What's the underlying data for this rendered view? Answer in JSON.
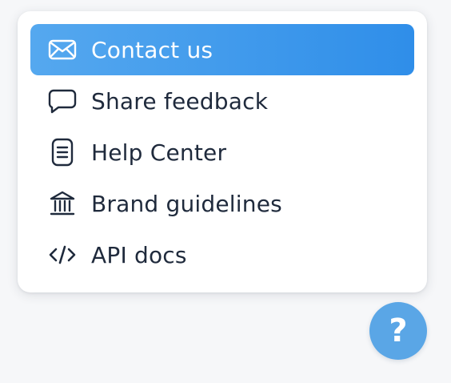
{
  "menu": {
    "items": [
      {
        "label": "Contact us",
        "icon": "envelope-icon",
        "active": true
      },
      {
        "label": "Share feedback",
        "icon": "chat-bubble-icon",
        "active": false
      },
      {
        "label": "Help Center",
        "icon": "document-icon",
        "active": false
      },
      {
        "label": "Brand guidelines",
        "icon": "bank-icon",
        "active": false
      },
      {
        "label": "API docs",
        "icon": "code-icon",
        "active": false
      }
    ]
  },
  "help_button": {
    "label": "?",
    "icon": "question-icon"
  },
  "colors": {
    "active_start": "#55a8ef",
    "active_end": "#2f8ee9",
    "text": "#1f2a3c",
    "fab": "#5aa6e6"
  }
}
